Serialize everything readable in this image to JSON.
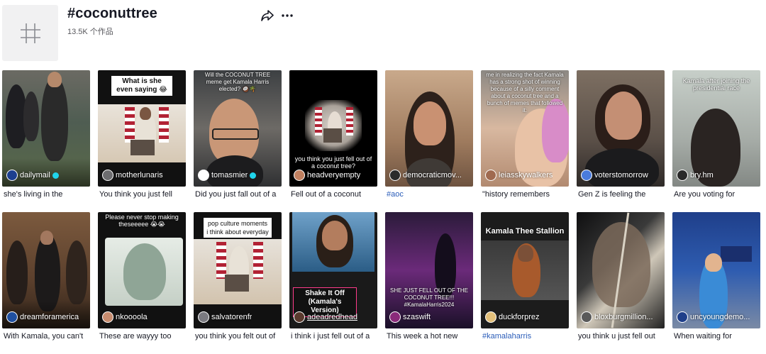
{
  "header": {
    "title": "#coconuttree",
    "subtitle": "13.5K 个作品"
  },
  "videos": [
    {
      "user": "dailymail",
      "verified": true,
      "desc": "she's living in the",
      "overlay": "",
      "pill": ""
    },
    {
      "user": "motherlunaris",
      "verified": false,
      "desc": "You think you just fell",
      "overlay": "",
      "pill": "What is she even saying 😂"
    },
    {
      "user": "tomasmier",
      "verified": true,
      "desc": "Did you just fall out of a",
      "overlay": "Will the COCONUT TREE meme get Kamala Harris elected? 🥥🌴",
      "pill": ""
    },
    {
      "user": "headveryempty",
      "verified": false,
      "desc": "Fell out of a coconut",
      "overlay": "you think you just fell out of a coconut tree?",
      "pill": ""
    },
    {
      "user": "democraticmov...",
      "verified": false,
      "desc": "#aoc",
      "overlay": "",
      "pill": ""
    },
    {
      "user": "leiasskywalkers",
      "verified": false,
      "desc": "\"history remembers",
      "overlay": "me in realizing the fact Kamala has a strong shot of winning because of a silly comment about a coconut tree and a bunch of memes that followed it:",
      "pill": ""
    },
    {
      "user": "voterstomorrow",
      "verified": false,
      "desc": "Gen Z is feeling the",
      "overlay": "",
      "pill": ""
    },
    {
      "user": "bry.hm",
      "verified": false,
      "desc": "Are you voting for",
      "overlay": "Kamala after joining the presidential race",
      "pill": ""
    },
    {
      "user": "dreamforamerica",
      "verified": false,
      "desc": "With Kamala, you can't",
      "overlay": "",
      "pill": ""
    },
    {
      "user": "nkoooola",
      "verified": false,
      "desc": "These are wayyy too",
      "overlay": "Please never stop making theseeeee 😭😭",
      "pill": ""
    },
    {
      "user": "salvatorenfr",
      "verified": false,
      "desc": "you think you felt out of",
      "overlay": "",
      "pill": "pop culture moments i think about everyday"
    },
    {
      "user": "adeadredhead",
      "verified": false,
      "desc": "i think i just fell out of a",
      "overlay": "",
      "pill": "Shake It Off (Kamala's Version)"
    },
    {
      "user": "szaswift",
      "verified": false,
      "desc": "This week a hot new",
      "overlay": "SHE JUST FELL OUT OF THE COCONUT TREE!!! #KamalaHarris2024",
      "pill": ""
    },
    {
      "user": "duckforprez",
      "verified": false,
      "desc": "#kamalaharris",
      "overlay": "Kamala Thee Stallion",
      "pill": ""
    },
    {
      "user": "bloxburgmillion...",
      "verified": false,
      "desc": "you think u just fell out",
      "overlay": "",
      "pill": ""
    },
    {
      "user": "uncyoungdemo...",
      "verified": false,
      "desc": "When waiting for",
      "overlay": "",
      "pill": ""
    }
  ],
  "colors": {
    "link": "#2b5db9",
    "text": "#161823",
    "muted": "#57575c",
    "avatar_bg": "#f1f1f2"
  },
  "icons": {
    "hashtag": "hashtag-icon",
    "share": "share-icon",
    "more": "more-icon"
  }
}
